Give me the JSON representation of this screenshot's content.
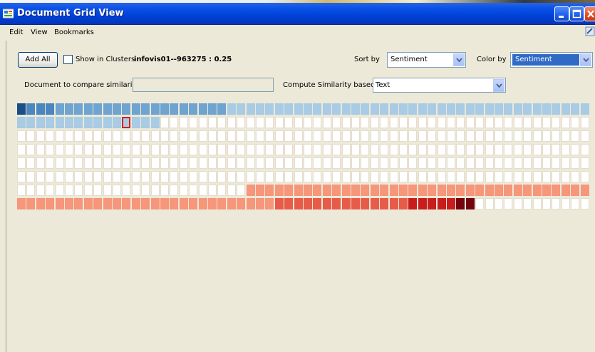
{
  "window": {
    "title": "Document Grid View"
  },
  "menu": [
    "Edit",
    "View",
    "Bookmarks"
  ],
  "toolbar": {
    "add_all_label": "Add All",
    "show_in_clusters_label": "Show in Clusters",
    "show_in_clusters_checked": false,
    "selected_document": "infovis01--963275 : 0.25",
    "sort_by_label": "Sort by",
    "sort_by_value": "Sentiment",
    "color_by_label": "Color by",
    "color_by_value": "Sentiment"
  },
  "similarity": {
    "compare_label": "Document to compare similarity to",
    "compare_value": "",
    "compute_label": "Compute Similarity based on",
    "compute_value": "Text"
  },
  "grid": {
    "columns": 60,
    "rows": 8,
    "selected_index": 71,
    "palette": {
      "empty": "#ffffff",
      "blue_dark": "#1b4d86",
      "blue_mid": "#4b86be",
      "blue": "#6fa3d0",
      "blue_light": "#a9cbe4",
      "salmon": "#f6967a",
      "red_mid": "#e75c49",
      "red": "#c91d1d",
      "red_dark": "#74040e",
      "border": "#e6dccd",
      "selected_outline": "#d42020"
    },
    "row_fills": [
      [
        [
          "blue_dark",
          1
        ],
        [
          "blue_mid",
          3
        ],
        [
          "blue",
          18
        ],
        [
          "blue_light",
          38
        ]
      ],
      [
        [
          "blue_light",
          15
        ],
        [
          "empty",
          45
        ]
      ],
      [
        [
          "empty",
          60
        ]
      ],
      [
        [
          "empty",
          60
        ]
      ],
      [
        [
          "empty",
          60
        ]
      ],
      [
        [
          "empty",
          60
        ]
      ],
      [
        [
          "empty",
          24
        ],
        [
          "salmon",
          36
        ]
      ],
      [
        [
          "salmon",
          27
        ],
        [
          "red_mid",
          14
        ],
        [
          "red",
          5
        ],
        [
          "red_dark",
          2
        ],
        [
          "empty",
          12
        ]
      ]
    ]
  }
}
